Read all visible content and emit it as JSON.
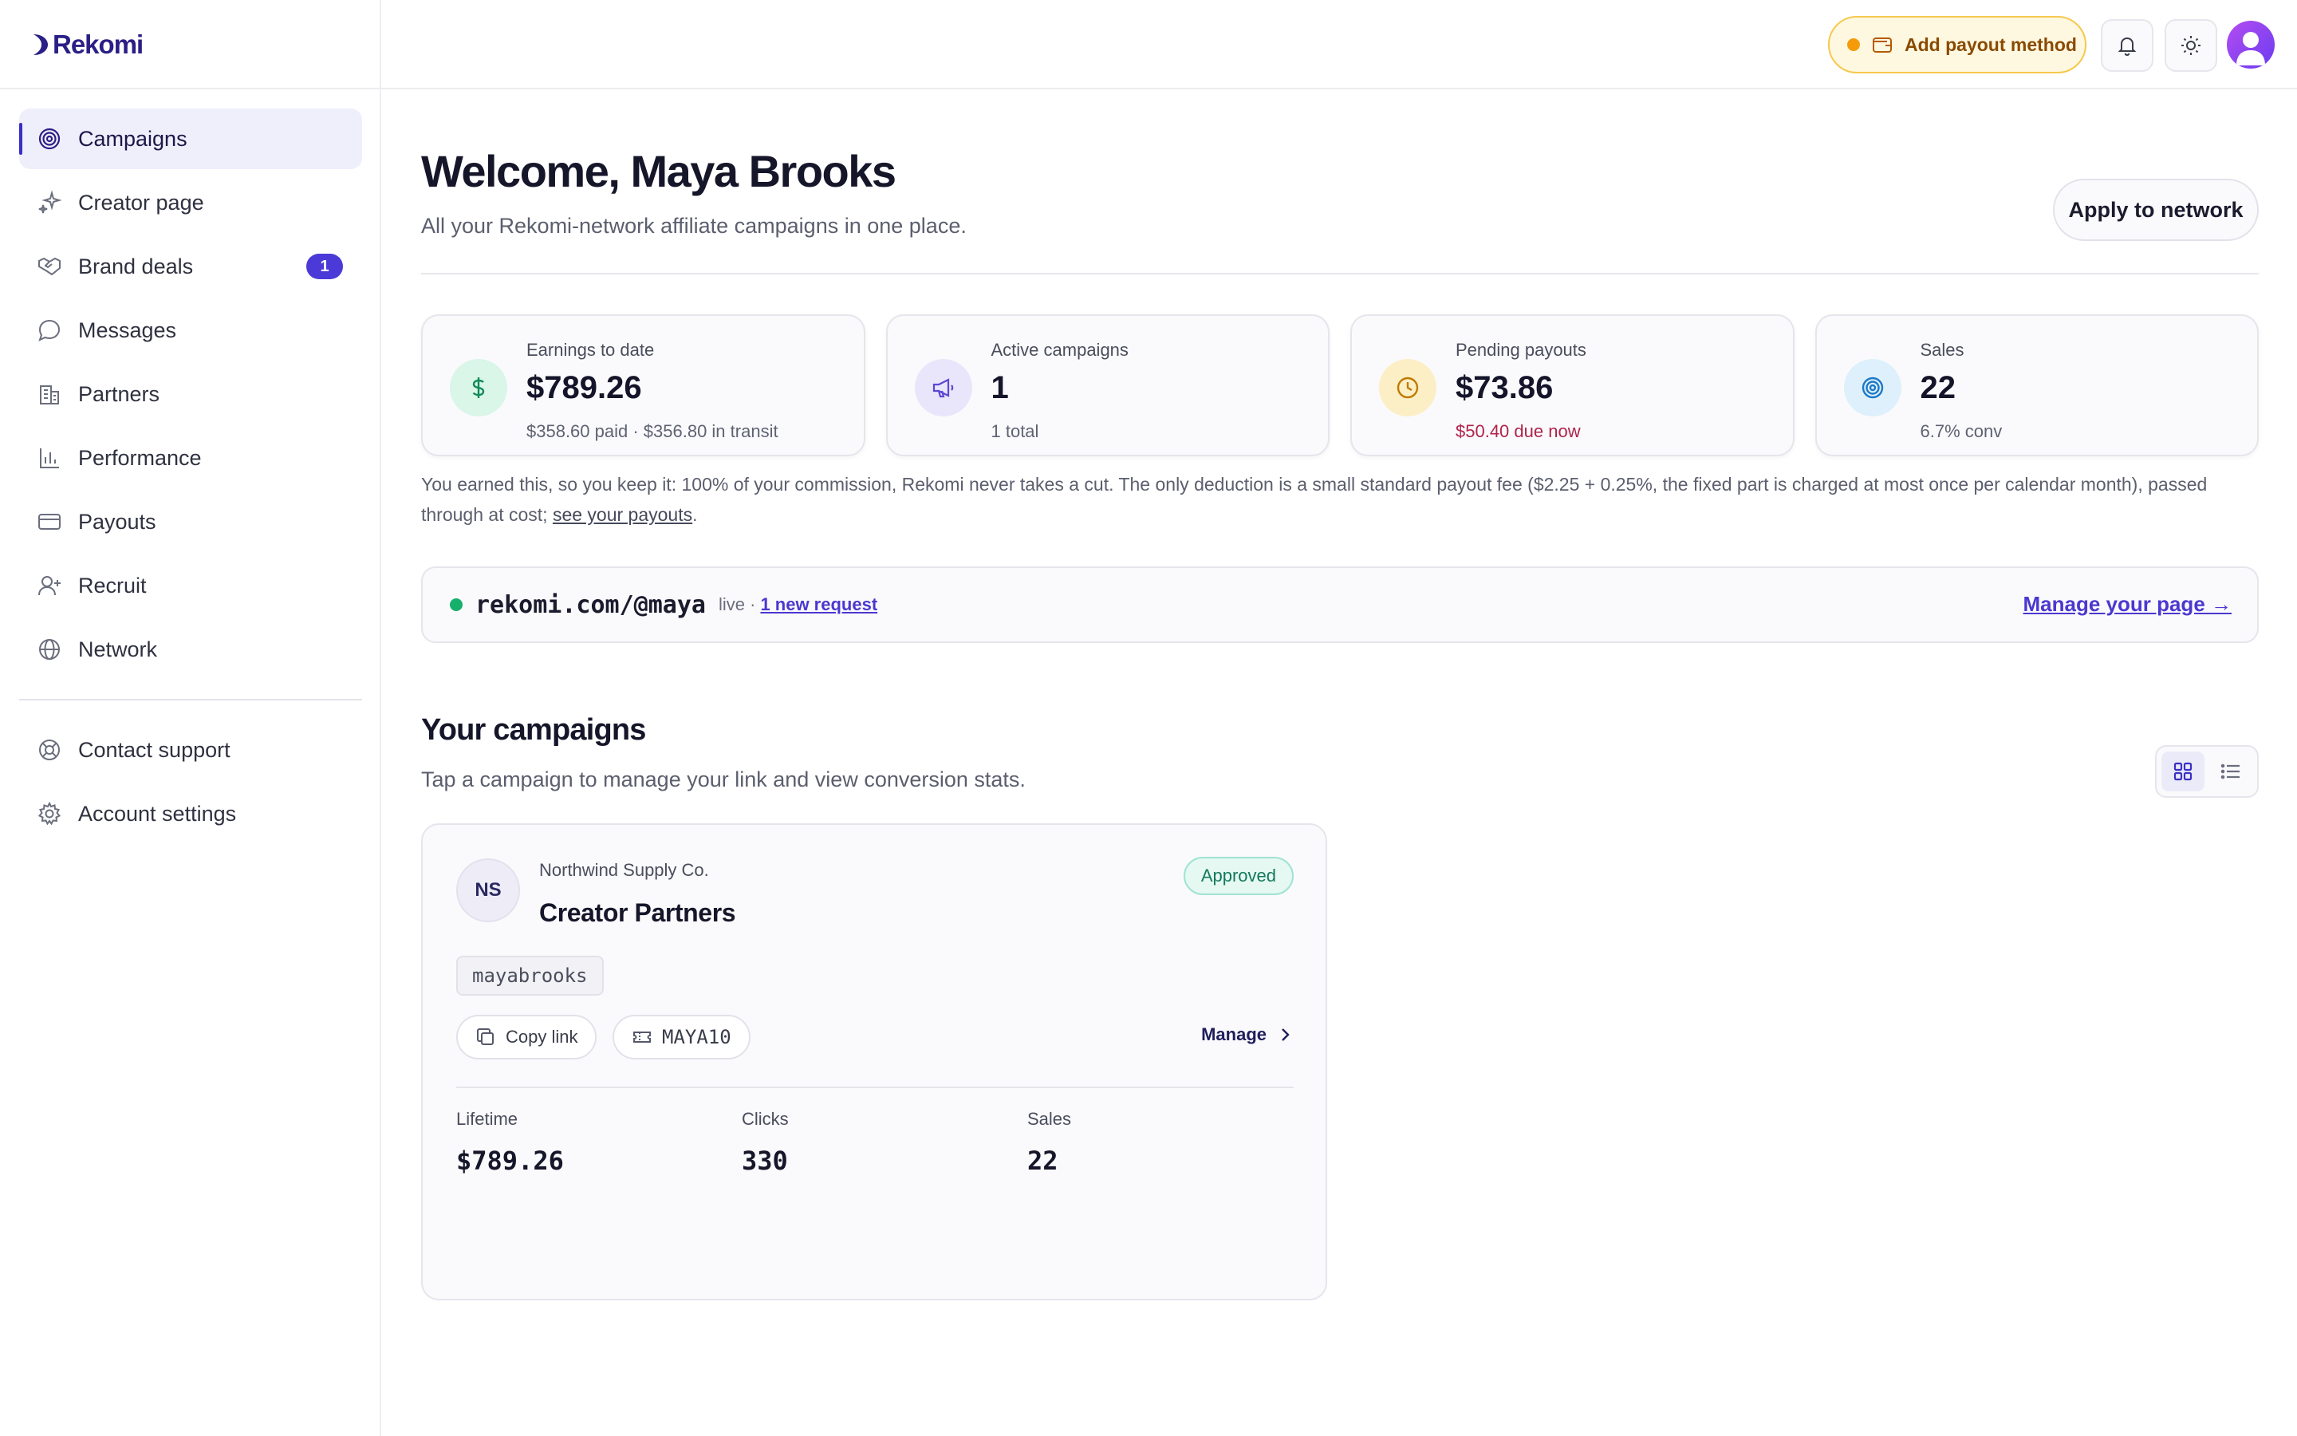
{
  "app": {
    "brand": "Rekomi"
  },
  "sidebar": {
    "items": [
      {
        "label": "Campaigns",
        "icon": "target-icon",
        "active": true
      },
      {
        "label": "Creator page",
        "icon": "sparkles-icon"
      },
      {
        "label": "Brand deals",
        "icon": "handshake-icon",
        "badge": "1"
      },
      {
        "label": "Messages",
        "icon": "chat-bubble-icon"
      },
      {
        "label": "Partners",
        "icon": "building-icon"
      },
      {
        "label": "Performance",
        "icon": "bar-chart-icon"
      },
      {
        "label": "Payouts",
        "icon": "credit-card-icon"
      },
      {
        "label": "Recruit",
        "icon": "user-plus-icon"
      },
      {
        "label": "Network",
        "icon": "globe-icon"
      }
    ],
    "bottom_items": [
      {
        "label": "Contact support",
        "icon": "lifebuoy-icon"
      },
      {
        "label": "Account settings",
        "icon": "gear-icon"
      }
    ]
  },
  "topbar": {
    "payout_label": "Add payout method",
    "status_color": "#f59b0b"
  },
  "header": {
    "welcome": "Welcome, Maya Brooks",
    "subtitle": "All your Rekomi-network affiliate campaigns in one place.",
    "apply_label": "Apply to network"
  },
  "stats": [
    {
      "label": "Earnings to date",
      "value": "$789.26",
      "sub": "$358.60 paid · $356.80 in transit",
      "icon": "dollar-icon"
    },
    {
      "label": "Active campaigns",
      "value": "1",
      "sub": "1 total",
      "icon": "megaphone-icon"
    },
    {
      "label": "Pending payouts",
      "value": "$73.86",
      "sub": "$50.40 due now",
      "icon": "clock-icon"
    },
    {
      "label": "Sales",
      "value": "22",
      "sub": "6.7% conv",
      "icon": "target-icon"
    }
  ],
  "note": {
    "text": "You earned this, so you keep it: 100% of your commission, Rekomi never takes a cut. The only deduction is a small standard payout fee ($2.25 + 0.25%, the fixed part is charged at most once per calendar month), passed through at cost;",
    "link": "see your payouts",
    "end": "."
  },
  "creator_link": {
    "url": "rekomi.com/@maya",
    "status": "live ·",
    "request": "1 new request",
    "manage": "Manage your page →"
  },
  "campaigns_section": {
    "title": "Your campaigns",
    "subtitle": "Tap a campaign to manage your link and view conversion stats."
  },
  "campaign": {
    "initials": "NS",
    "brand": "Northwind Supply Co.",
    "name": "Creator Partners",
    "status": "Approved",
    "handle": "mayabrooks",
    "copy_label": "Copy link",
    "code": "MAYA10",
    "manage_label": "Manage",
    "metrics": [
      {
        "label": "Lifetime",
        "value": "$789.26"
      },
      {
        "label": "Clicks",
        "value": "330"
      },
      {
        "label": "Sales",
        "value": "22"
      }
    ]
  }
}
